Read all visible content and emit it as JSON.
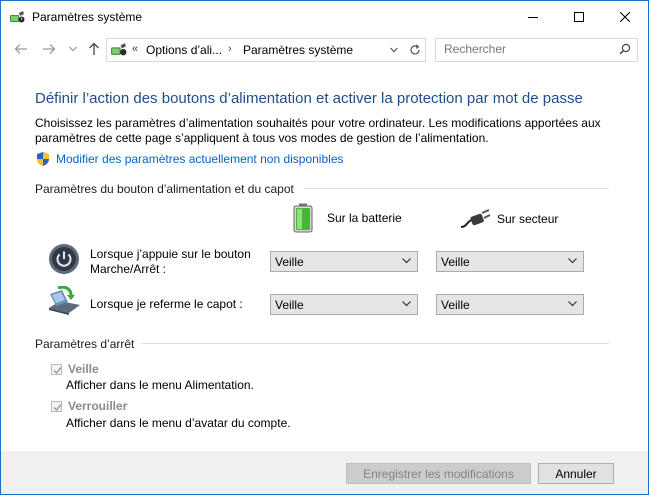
{
  "window": {
    "title": "Paramètres système",
    "icon": "power-options-icon"
  },
  "nav": {
    "back_icon": "back-arrow-icon",
    "forward_icon": "forward-arrow-icon",
    "recent_icon": "chevron-down-icon",
    "up_icon": "up-arrow-icon"
  },
  "address": {
    "prefix": "«",
    "crumbs": [
      "Options d’ali...",
      "Paramètres système"
    ],
    "separator": "›"
  },
  "search": {
    "placeholder": "Rechercher"
  },
  "main": {
    "heading": "Définir l’action des boutons d’alimentation et activer la protection par mot de passe",
    "description": "Choisissez les paramètres d’alimentation souhaités pour votre ordinateur. Les modifications apportées aux paramètres de cette page s’appliquent à tous vos modes de gestion de l’alimentation.",
    "admin_link": "Modifier des paramètres actuellement non disponibles"
  },
  "power_section": {
    "title": "Paramètres du bouton d’alimentation et du capot",
    "col_battery": "Sur la batterie",
    "col_plugged": "Sur secteur",
    "rows": [
      {
        "label_line1": "Lorsque j’appuie sur le bouton",
        "label_line2": "Marche/Arrêt :",
        "battery": "Veille",
        "plugged": "Veille"
      },
      {
        "label_line1": "Lorsque je referme le capot :",
        "label_line2": "",
        "battery": "Veille",
        "plugged": "Veille"
      }
    ]
  },
  "shutdown_section": {
    "title": "Paramètres d’arrêt",
    "items": [
      {
        "label": "Veille",
        "description": "Afficher dans le menu Alimentation.",
        "checked": true
      },
      {
        "label": "Verrouiller",
        "description": "Afficher dans le menu d’avatar du compte.",
        "checked": true
      }
    ]
  },
  "footer": {
    "save_label": "Enregistrer les modifications",
    "cancel_label": "Annuler"
  },
  "colors": {
    "heading": "#1e4e8c",
    "link": "#0066cc",
    "window_border": "#1b6fc4"
  }
}
